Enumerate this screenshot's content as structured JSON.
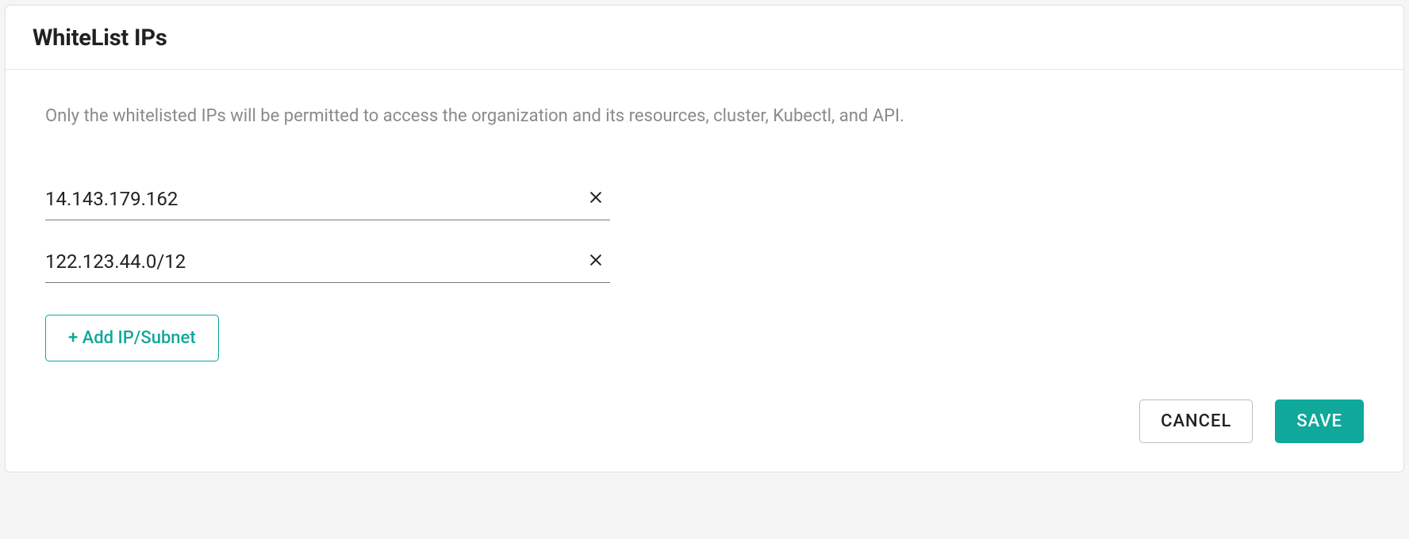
{
  "header": {
    "title": "WhiteList IPs"
  },
  "description": "Only the whitelisted IPs will be permitted to access the organization and its resources, cluster, Kubectl, and API.",
  "ip_entries": [
    {
      "value": "14.143.179.162"
    },
    {
      "value": "122.123.44.0/12"
    }
  ],
  "add_button_label": "+ Add IP/Subnet",
  "actions": {
    "cancel_label": "CANCEL",
    "save_label": "SAVE"
  },
  "colors": {
    "accent": "#0fa89a"
  }
}
